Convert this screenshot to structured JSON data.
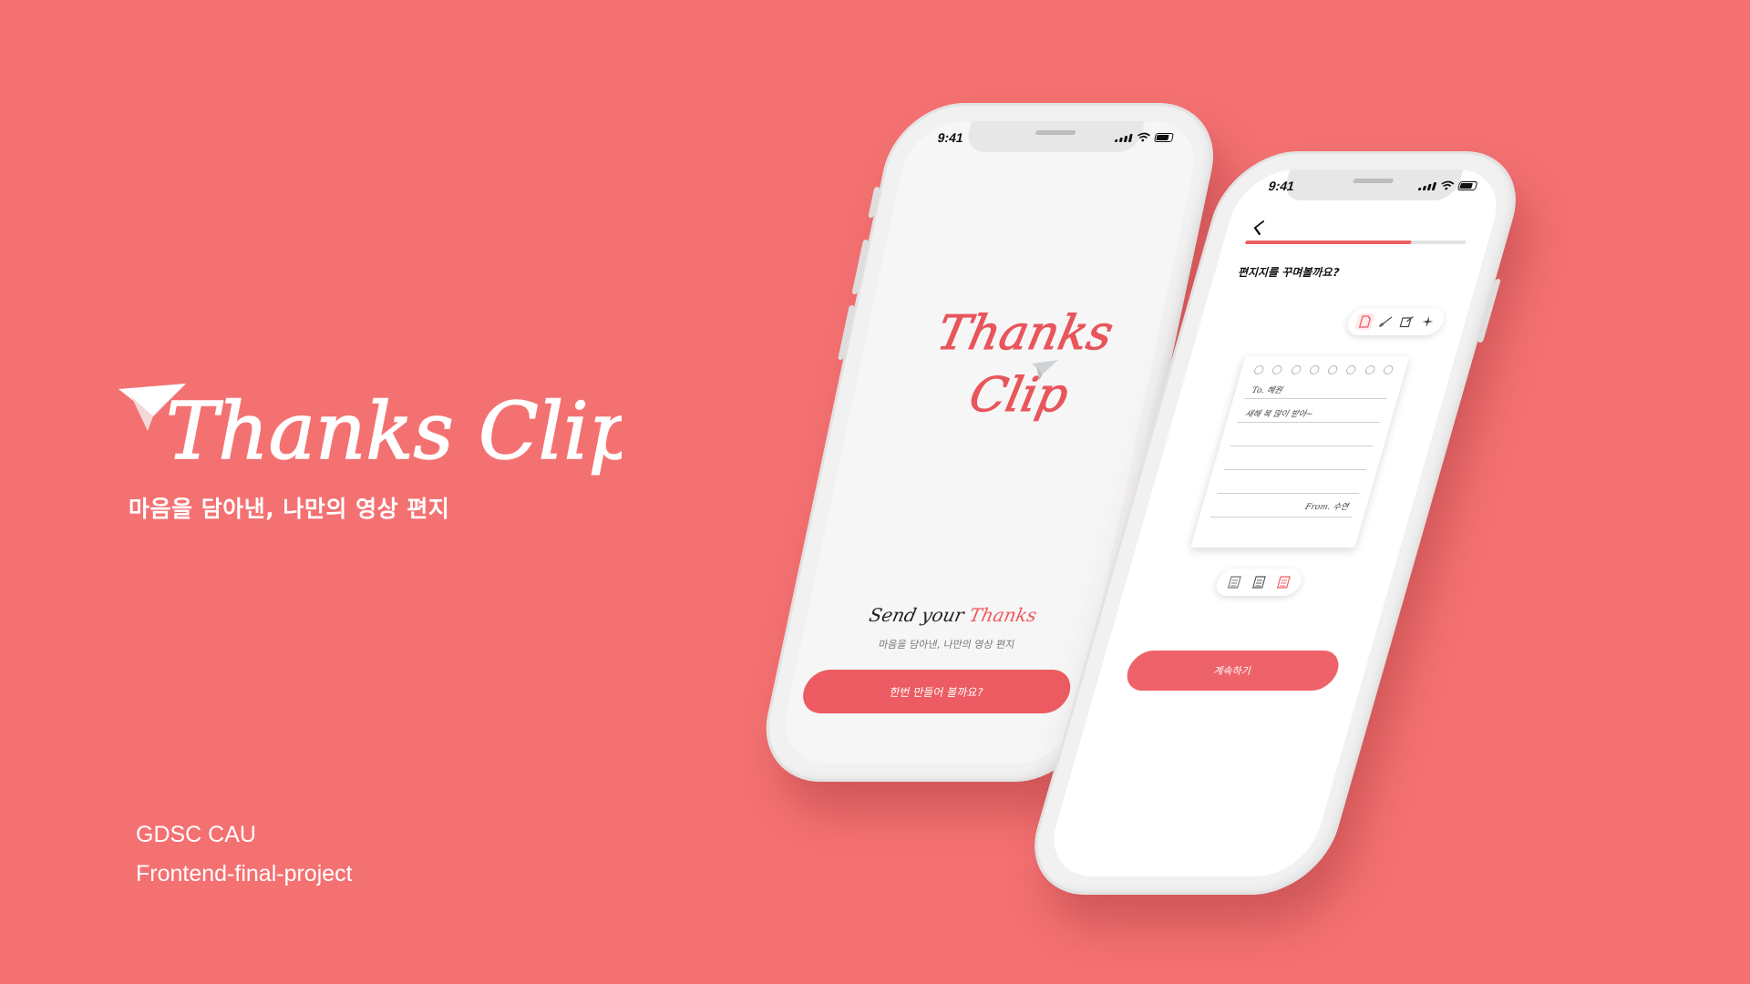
{
  "brand": {
    "logo_text": "Thanks Clip",
    "tagline": "마음을 담아낸, 나만의 영상 편지",
    "credits": [
      "GDSC CAU",
      "Frontend-final-project"
    ]
  },
  "colors": {
    "background": "#F47172",
    "accent": "#EC5C62",
    "white": "#FFFFFF"
  },
  "phone_splash": {
    "status_time": "9:41",
    "logo_line_1": "Thanks",
    "logo_line_2": "Clip",
    "send_prefix": "Send your",
    "send_accent": "Thanks",
    "subtitle": "마음을 담아낸, 나만의 영상 편지",
    "cta_label": "한번 만들어 볼까요?"
  },
  "phone_editor": {
    "status_time": "9:41",
    "question": "편지지를 꾸며볼까요?",
    "progress_percent": 75,
    "letter_to": "To. 혜원",
    "letter_body": "새해 복 많이 받아~",
    "letter_from": "From. 수연",
    "toolbar_icons": [
      "document-icon",
      "brush-icon",
      "pen-icon",
      "sparkle-icon"
    ],
    "template_icons": [
      "template-gray-1-icon",
      "template-gray-2-icon",
      "template-red-icon"
    ],
    "cta_label": "계속하기"
  }
}
